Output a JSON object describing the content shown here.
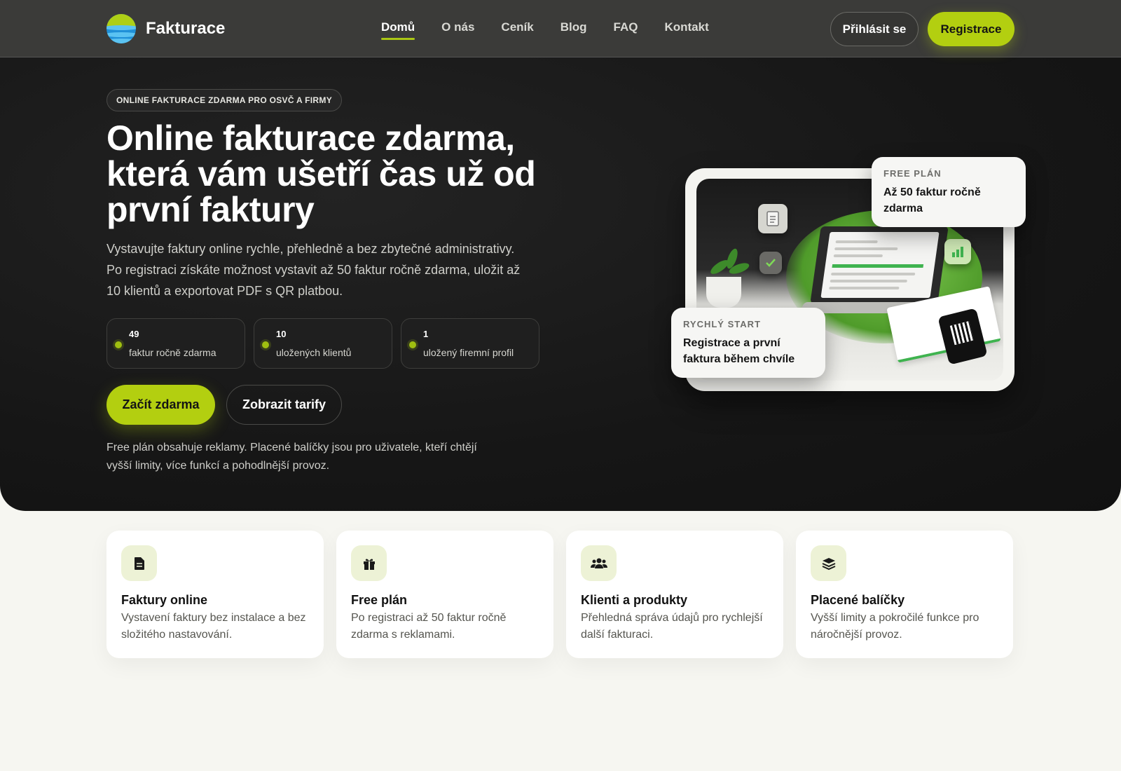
{
  "brand": {
    "name": "Fakturace"
  },
  "nav": {
    "items": [
      {
        "label": "Domů",
        "active": true
      },
      {
        "label": "O nás",
        "active": false
      },
      {
        "label": "Ceník",
        "active": false
      },
      {
        "label": "Blog",
        "active": false
      },
      {
        "label": "FAQ",
        "active": false
      },
      {
        "label": "Kontakt",
        "active": false
      }
    ],
    "login_label": "Přihlásit se",
    "register_label": "Registrace"
  },
  "hero": {
    "kicker": "ONLINE FAKTURACE ZDARMA PRO OSVČ A FIRMY",
    "title": "Online fakturace zdarma, která vám ušetří čas už od první faktury",
    "description": "Vystavujte faktury online rychle, přehledně a bez zbytečné administrativy. Po registraci získáte možnost vystavit až 50 faktur ročně zdarma, uložit až 10 klientů a exportovat PDF s QR platbou.",
    "stats": [
      {
        "value": "49",
        "label": "faktur ročně zdarma"
      },
      {
        "value": "10",
        "label": "uložených klientů"
      },
      {
        "value": "1",
        "label": "uložený firemní profil"
      }
    ],
    "primary_cta": "Začít zdarma",
    "secondary_cta": "Zobrazit tarify",
    "note": "Free plán obsahuje reklamy. Placené balíčky jsou pro uživatele, kteří chtějí vyšší limity, více funkcí a pohodlnější provoz."
  },
  "visual": {
    "free_badge": {
      "kicker": "FREE PLÁN",
      "text": "Až 50 faktur ročně zdarma"
    },
    "quick_badge": {
      "kicker": "RYCHLÝ START",
      "text": "Registrace a první faktura během chvíle"
    }
  },
  "features": [
    {
      "icon": "document-icon",
      "title": "Faktury online",
      "desc": "Vystavení faktury bez instalace a bez složitého nastavování."
    },
    {
      "icon": "gift-icon",
      "title": "Free plán",
      "desc": "Po registraci až 50 faktur ročně zdarma s reklamami."
    },
    {
      "icon": "users-icon",
      "title": "Klienti a produkty",
      "desc": "Přehledná správa údajů pro rychlejší další fakturaci."
    },
    {
      "icon": "layers-icon",
      "title": "Placené balíčky",
      "desc": "Vyšší limity a pokročilé funkce pro náročnější provoz."
    }
  ],
  "colors": {
    "accent": "#b3cf10",
    "dark": "#161616",
    "nav": "#3b3b39",
    "page": "#f6f6f1"
  }
}
